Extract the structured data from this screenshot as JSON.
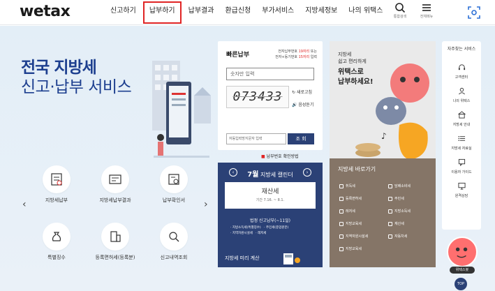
{
  "header": {
    "logo": "wetax",
    "nav": [
      "신고하기",
      "납부하기",
      "납부결과",
      "환급신청",
      "부가서비스",
      "지방세정보",
      "나의 위택스"
    ],
    "icons": [
      {
        "name": "search-icon",
        "label": "통합검색"
      },
      {
        "name": "menu-icon",
        "label": "전체메뉴"
      }
    ]
  },
  "hero": {
    "title": "전국 지방세",
    "subtitle": "신고·납부 서비스"
  },
  "services": [
    {
      "label": "지방세납부"
    },
    {
      "label": "지방세납부결과"
    },
    {
      "label": "납부확인서"
    },
    {
      "label": "특별징수"
    },
    {
      "label": "등록면허세(등록분)"
    },
    {
      "label": "신고내역조회"
    }
  ],
  "login_card": {
    "title": "빠른납부",
    "desc_l1": "전자납부번호 ",
    "desc_l1r": "19자리",
    "desc_l1b": " 또는",
    "desc_l2": "전자+등기번호 ",
    "desc_l2r": "15자리",
    "desc_l2b": " 입력",
    "input_placeholder": "숫자만 입력",
    "captcha": "073433",
    "refresh": "새로고침",
    "audio": "음성듣기",
    "captcha_placeholder": "자동입력방지문자 입력",
    "submit": "조 회",
    "link": "납부번호 확인방법"
  },
  "promo": {
    "small_l1": "지방세",
    "small_l2": "쉽고 편리하게",
    "big_l1": "위택스로",
    "big_l2": "납부하세요!"
  },
  "calendar": {
    "month": "7월",
    "title": "지방세 캘린더",
    "tax": "재산세",
    "period": "기간 7.16. ~ 8.1.",
    "section": "법정 신고납부(~11일)",
    "items": [
      "지방소득세(특별징수)",
      "주민세(종업원분)",
      "지역자원시설세",
      "레저세"
    ],
    "footer": "지방세 미리 계산"
  },
  "shortcut": {
    "title": "지방세 바로가기",
    "items": [
      "취득세",
      "담배소비세",
      "등록면허세",
      "주민세",
      "레저세",
      "지방소득세",
      "지방교육세",
      "재산세",
      "지역자원시설세",
      "자동차세",
      "지방교육세"
    ]
  },
  "quick": {
    "title": "자주찾는 서비스",
    "items": [
      "고객센터",
      "나의 위택스",
      "지방세 안내",
      "지방세 자료실",
      "이용자 가이드",
      "원격상담"
    ],
    "mascot": "위택스봇",
    "top": "TOP"
  },
  "colors": {
    "primary": "#2b4176",
    "accent": "#e02424",
    "hero": "#1d3f8f",
    "shortcut_bg": "#857567"
  }
}
